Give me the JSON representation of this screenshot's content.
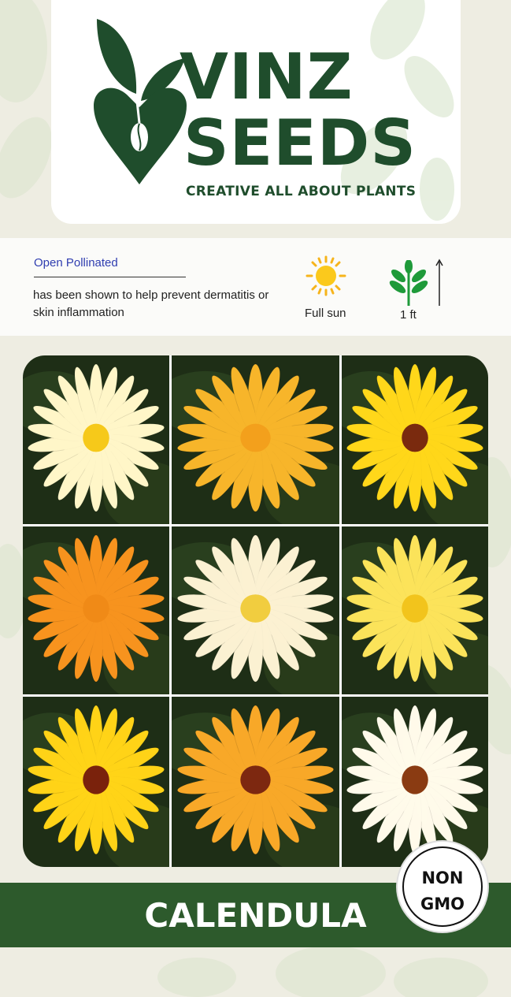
{
  "brand": {
    "line1": "VINZ",
    "line2": "SEEDS",
    "tagline": "CREATIVE ALL ABOUT PLANTS",
    "color": "#1f4d2c"
  },
  "info": {
    "pollination": "Open Pollinated",
    "description": " has been shown to help prevent dermatitis or skin inflammation",
    "sun_label": "Full sun",
    "height_label": "1  ft"
  },
  "icons": [
    "seed-heart-logo-icon",
    "sun-icon",
    "plant-sprout-icon",
    "up-arrow-icon"
  ],
  "photos": [
    {
      "name": "calendula-white-yellow",
      "petal": "#fff6c8",
      "center": "#f6c91a"
    },
    {
      "name": "calendula-orange-cream",
      "petal": "#f7b52a",
      "center": "#f3a01c"
    },
    {
      "name": "calendula-yellow-dark-center",
      "petal": "#ffd71a",
      "center": "#7a2a0e"
    },
    {
      "name": "calendula-orange",
      "petal": "#f7931e",
      "center": "#f08a17"
    },
    {
      "name": "calendula-cream",
      "petal": "#fbf1d2",
      "center": "#f1cd3f"
    },
    {
      "name": "calendula-lemon",
      "petal": "#fbe35a",
      "center": "#f2c41c"
    },
    {
      "name": "calendula-gold",
      "petal": "#ffd317",
      "center": "#7a220c"
    },
    {
      "name": "calendula-orange-dark-center",
      "petal": "#f8a828",
      "center": "#7d2810"
    },
    {
      "name": "calendula-white",
      "petal": "#fffaea",
      "center": "#8a3b12"
    }
  ],
  "product_name": "CALENDULA",
  "badge": {
    "line1": "NON",
    "line2": "GMO"
  },
  "colors": {
    "band": "#2d5a2c",
    "background": "#eeede2",
    "link": "#2f3db0"
  }
}
